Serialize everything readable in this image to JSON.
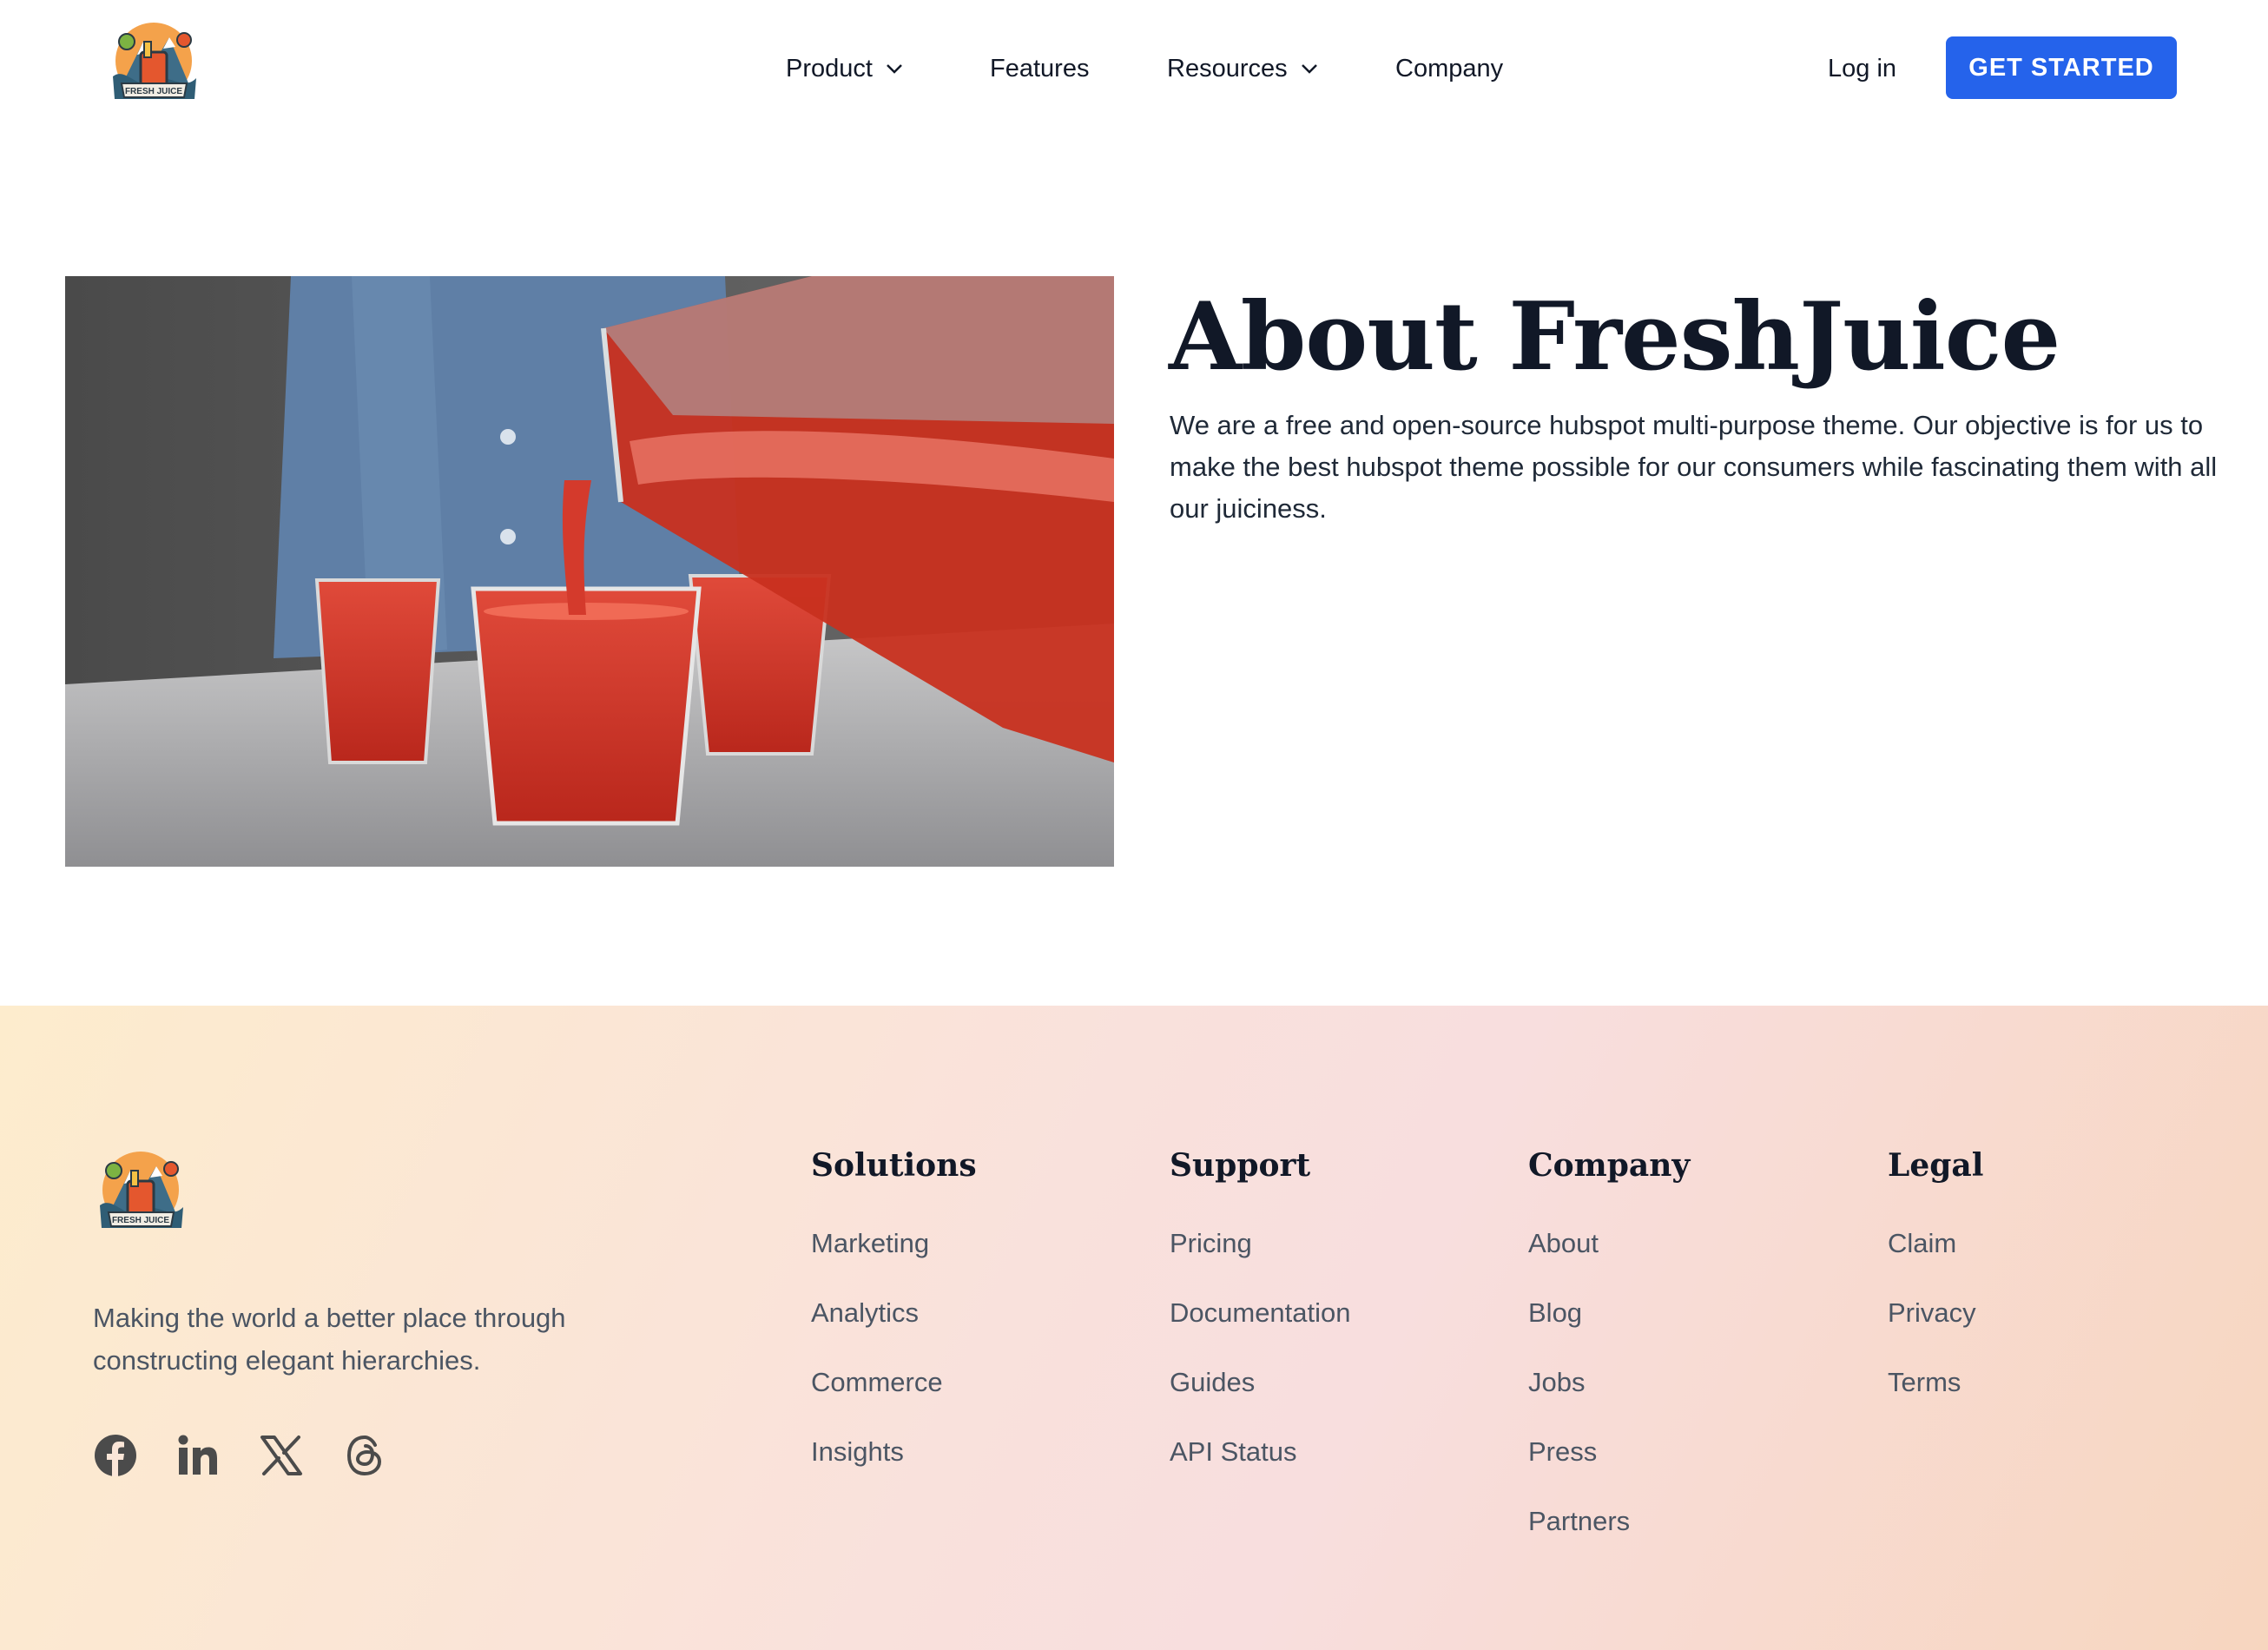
{
  "brand": {
    "logo_text": "FRESH JUICE"
  },
  "nav": {
    "items": [
      {
        "label": "Product",
        "has_dropdown": true
      },
      {
        "label": "Features",
        "has_dropdown": false
      },
      {
        "label": "Resources",
        "has_dropdown": true
      },
      {
        "label": "Company",
        "has_dropdown": false
      }
    ],
    "login_label": "Log in",
    "cta_label": "GET STARTED"
  },
  "hero": {
    "title": "About FreshJuice",
    "description": "We are a free and open-source hubspot multi-purpose theme. Our objective is for us to make the best hubspot theme possible for our consumers while fascinating them with all our juiciness.",
    "image_subject": "juice-pouring-photo"
  },
  "footer": {
    "tagline": "Making the world a better place through constructing elegant hierarchies.",
    "social": [
      "facebook-icon",
      "linkedin-icon",
      "x-icon",
      "threads-icon"
    ],
    "columns": [
      {
        "title": "Solutions",
        "links": [
          "Marketing",
          "Analytics",
          "Commerce",
          "Insights"
        ]
      },
      {
        "title": "Support",
        "links": [
          "Pricing",
          "Documentation",
          "Guides",
          "API Status"
        ]
      },
      {
        "title": "Company",
        "links": [
          "About",
          "Blog",
          "Jobs",
          "Press",
          "Partners"
        ]
      },
      {
        "title": "Legal",
        "links": [
          "Claim",
          "Privacy",
          "Terms"
        ]
      }
    ]
  },
  "colors": {
    "accent": "#2563eb",
    "heading": "#111827",
    "body_text": "#1f2937",
    "muted_text": "#4b5563"
  }
}
